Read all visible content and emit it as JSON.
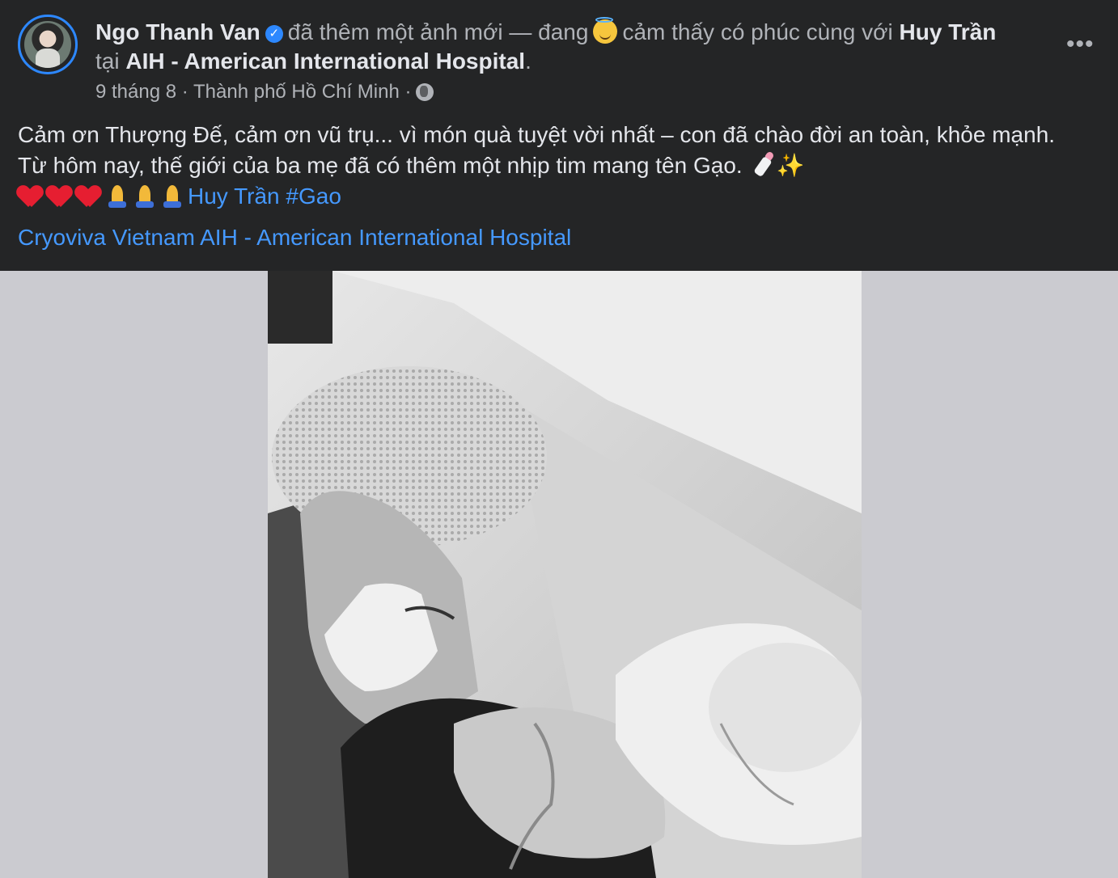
{
  "post": {
    "author": "Ngo Thanh Van",
    "action_text": "đã thêm một ảnh mới — đang",
    "feeling_text": "cảm thấy có phúc cùng với",
    "tagged_person": "Huy Trần",
    "location_prefix": "tại",
    "location": "AIH - American International Hospital",
    "location_suffix": ".",
    "date": "9 tháng 8",
    "separator": "·",
    "city": "Thành phố Hồ Chí Minh",
    "more_label": "•••",
    "caption_line1": "Cảm ơn Thượng Đế, cảm ơn vũ trụ... vì món quà tuyệt vời nhất – con đã chào đời an toàn, khỏe mạnh.",
    "caption_line2": "Từ hôm nay, thế giới của ba mẹ đã có thêm một nhịp tim mang tên Gạo.",
    "mention": "Huy Trần",
    "hashtag": "#Gao",
    "tags_line": "Cryoviva Vietnam AIH - American International Hospital",
    "sparkle": "✨"
  },
  "icons": {
    "verified": "verified-badge-icon",
    "feeling": "smiling-face-with-halo-icon",
    "privacy": "globe-icon",
    "hearts": "red-heart-icon",
    "pray": "folded-hands-icon",
    "bottle": "baby-bottle-icon",
    "sparkles": "sparkles-icon"
  },
  "colors": {
    "header_bg": "#242526",
    "text_primary": "#e4e6eb",
    "text_secondary": "#b0b3b8",
    "link": "#4599ff",
    "avatar_ring": "#2d88ff",
    "page_bg": "#cbcbd0"
  }
}
